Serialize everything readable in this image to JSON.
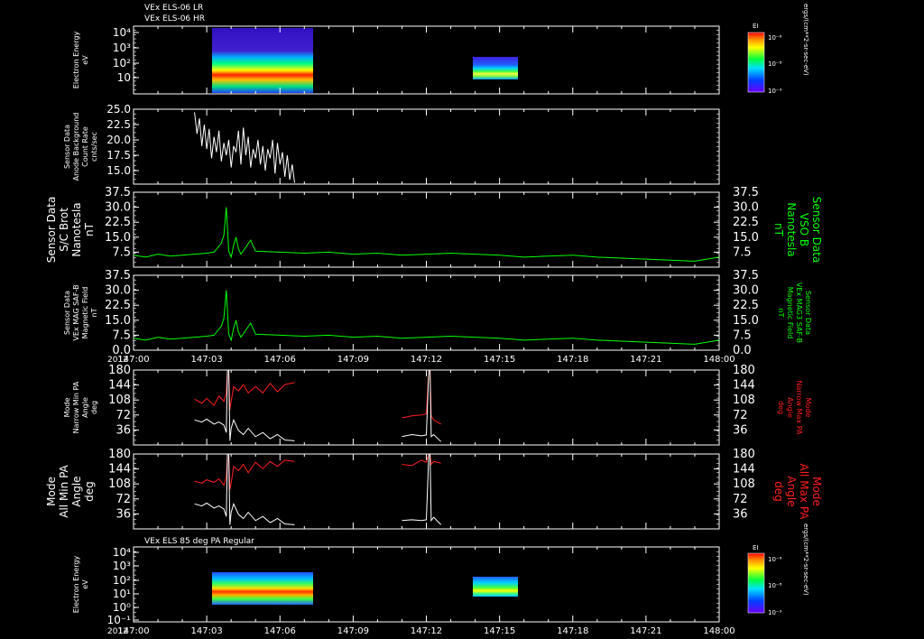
{
  "header": {
    "line1": "VEx ELS-06 LR",
    "line2": "VEx ELS-06 HR"
  },
  "colors": {
    "bg": "#000000",
    "axis": "#ffffff",
    "green": "#00ff00",
    "red": "#ff2020",
    "white": "#ffffff"
  },
  "colorbar": {
    "title": "EI",
    "units": "ergs/(cm**2-sr-sec-eV)",
    "ticks": [
      "10⁻⁶",
      "10⁻⁸",
      "10⁻⁹"
    ]
  },
  "time_axis": {
    "year": "2012",
    "ticks": [
      "147:00",
      "147:03",
      "147:06",
      "147:09",
      "147:12",
      "147:15",
      "147:18",
      "147:21",
      "148:00"
    ]
  },
  "chart_data": [
    {
      "type": "heatmap",
      "ylabel": [
        "Electron Energy",
        "eV"
      ],
      "yticks": [
        "10⁴",
        "10³",
        "10²",
        "10"
      ],
      "log_y": true,
      "colorbar": true,
      "blocks_minutes": [
        [
          2.4,
          6.6
        ],
        [
          11.0,
          12.7
        ]
      ]
    },
    {
      "type": "line",
      "ylabel": [
        "Sensor Data",
        "Anode Background",
        "Count Rate",
        "cnts/sec"
      ],
      "yticks": [
        "25.0",
        "22.5",
        "20.0",
        "17.5",
        "15.0"
      ],
      "ylim": [
        12.8,
        25.0
      ],
      "color": "white",
      "x_minutes": [
        2.5,
        2.6,
        2.7,
        2.8,
        2.9,
        3.0,
        3.1,
        3.2,
        3.3,
        3.4,
        3.5,
        3.6,
        3.7,
        3.8,
        3.9,
        4.0,
        4.1,
        4.2,
        4.3,
        4.4,
        4.5,
        4.6,
        4.7,
        4.8,
        4.9,
        5.0,
        5.1,
        5.2,
        5.3,
        5.4,
        5.5,
        5.6,
        5.7,
        5.8,
        5.9,
        6.0,
        6.1,
        6.2,
        6.3,
        6.4,
        6.5,
        6.6
      ],
      "values": [
        24.5,
        21.0,
        23.5,
        19.0,
        22.5,
        18.5,
        21.8,
        17.0,
        20.5,
        18.0,
        21.5,
        16.5,
        19.5,
        17.5,
        20.0,
        15.5,
        19.0,
        18.0,
        21.5,
        16.0,
        22.0,
        17.5,
        20.5,
        15.5,
        18.5,
        17.0,
        20.0,
        16.0,
        19.0,
        15.0,
        18.5,
        17.0,
        20.0,
        14.5,
        19.5,
        16.0,
        18.0,
        14.0,
        17.5,
        13.5,
        16.0,
        13.0
      ]
    },
    {
      "type": "line",
      "ylabel": [
        "Sensor Data",
        "S/C Brot",
        "Nanotesla",
        "nT"
      ],
      "ylabel_right": [
        "Sensor Data",
        "VSO B",
        "Nanotesla",
        "nT"
      ],
      "yticks": [
        "37.5",
        "30.0",
        "22.5",
        "15.0",
        "7.5"
      ],
      "ylim": [
        0,
        37.5
      ],
      "color": "green",
      "x_minutes": [
        0,
        0.5,
        1.0,
        1.5,
        2.0,
        2.5,
        3.0,
        3.3,
        3.6,
        3.7,
        3.8,
        3.9,
        4.0,
        4.1,
        4.2,
        4.3,
        4.4,
        4.6,
        4.8,
        5.0,
        6.0,
        7.0,
        8.0,
        9.0,
        10.0,
        11.0,
        12.0,
        13.0,
        14.0,
        15.0,
        16.0,
        17.0,
        18.0,
        19.0,
        20.0,
        21.0,
        22.0,
        23.0,
        24.0
      ],
      "values": [
        6.0,
        5.0,
        6.5,
        5.5,
        6.0,
        6.5,
        7.0,
        7.5,
        12.0,
        16.0,
        30.0,
        8.0,
        5.0,
        11.0,
        15.0,
        9.0,
        6.5,
        10.0,
        13.5,
        8.0,
        7.5,
        7.0,
        7.5,
        6.5,
        7.0,
        6.0,
        6.5,
        7.0,
        6.5,
        6.0,
        5.0,
        5.5,
        6.0,
        5.0,
        4.5,
        4.0,
        3.5,
        3.0,
        5.0
      ]
    },
    {
      "type": "line",
      "ylabel": [
        "Sensor Data",
        "VEx MAG SAF-B",
        "Magnetic Field",
        "nT"
      ],
      "ylabel_right": [
        "Sensor Data",
        "VEx MAG3 SAF-B",
        "Magnetic Field",
        "nT"
      ],
      "yticks": [
        "37.5",
        "30.0",
        "22.5",
        "15.0",
        "7.5",
        "0.0"
      ],
      "ylim": [
        0,
        37.5
      ],
      "color": "green",
      "x_minutes": [
        0,
        0.5,
        1.0,
        1.5,
        2.0,
        2.5,
        3.0,
        3.3,
        3.6,
        3.7,
        3.8,
        3.9,
        4.0,
        4.1,
        4.2,
        4.3,
        4.4,
        4.6,
        4.8,
        5.0,
        6.0,
        7.0,
        8.0,
        9.0,
        10.0,
        11.0,
        12.0,
        13.0,
        14.0,
        15.0,
        16.0,
        17.0,
        18.0,
        19.0,
        20.0,
        21.0,
        22.0,
        23.0,
        24.0
      ],
      "values": [
        6.0,
        5.0,
        6.5,
        5.5,
        6.0,
        6.5,
        7.0,
        7.5,
        12.0,
        16.0,
        30.0,
        8.0,
        5.0,
        11.0,
        15.0,
        9.0,
        6.5,
        10.0,
        13.5,
        8.0,
        7.5,
        7.0,
        7.5,
        6.5,
        7.0,
        6.0,
        6.5,
        7.0,
        6.5,
        6.0,
        5.0,
        5.5,
        6.0,
        5.0,
        4.5,
        4.0,
        3.5,
        3.0,
        5.0
      ]
    },
    {
      "type": "line",
      "ylabel": [
        "Mode",
        "Narrow Min PA",
        "Angle",
        "deg"
      ],
      "ylabel_right": [
        "Mode",
        "Narrow Max PA",
        "Angle",
        "deg"
      ],
      "yticks": [
        "180",
        "144",
        "108",
        "72",
        "36"
      ],
      "ylim": [
        0,
        180
      ],
      "series": [
        {
          "color": "red",
          "x_minutes": [
            2.5,
            2.8,
            3.0,
            3.3,
            3.5,
            3.7,
            3.8,
            3.85,
            3.9,
            3.95,
            4.0,
            4.1,
            4.3,
            4.5,
            4.7,
            5.0,
            5.3,
            5.6,
            5.9,
            6.2,
            6.6,
            null,
            11.0,
            11.4,
            11.8,
            12.0,
            12.1,
            12.15,
            12.2,
            12.3,
            12.6
          ],
          "values": [
            110,
            100,
            112,
            95,
            118,
            105,
            125,
            180,
            180,
            85,
            105,
            140,
            130,
            145,
            125,
            140,
            125,
            148,
            128,
            145,
            150,
            null,
            65,
            70,
            72,
            75,
            180,
            180,
            70,
            60,
            50
          ]
        },
        {
          "color": "white",
          "x_minutes": [
            2.5,
            2.8,
            3.0,
            3.3,
            3.5,
            3.7,
            3.8,
            3.85,
            3.9,
            3.95,
            4.0,
            4.1,
            4.3,
            4.5,
            4.7,
            5.0,
            5.3,
            5.6,
            5.9,
            6.2,
            6.6,
            null,
            11.0,
            11.4,
            11.8,
            12.0,
            12.1,
            12.15,
            12.2,
            12.3,
            12.6
          ],
          "values": [
            60,
            55,
            62,
            50,
            55,
            48,
            30,
            180,
            180,
            10,
            40,
            60,
            35,
            25,
            40,
            20,
            30,
            15,
            25,
            12,
            10,
            null,
            20,
            25,
            22,
            24,
            180,
            180,
            20,
            25,
            8
          ]
        }
      ]
    },
    {
      "type": "line",
      "ylabel": [
        "Mode",
        "All Min PA",
        "Angle",
        "deg"
      ],
      "ylabel_right": [
        "Mode",
        "All Max PA",
        "Angle",
        "deg"
      ],
      "yticks": [
        "180",
        "144",
        "108",
        "72",
        "36"
      ],
      "ylim": [
        0,
        180
      ],
      "series": [
        {
          "color": "red",
          "x_minutes": [
            2.5,
            2.8,
            3.0,
            3.3,
            3.5,
            3.7,
            3.8,
            3.85,
            3.9,
            3.95,
            4.0,
            4.1,
            4.3,
            4.5,
            4.7,
            5.0,
            5.3,
            5.6,
            5.9,
            6.2,
            6.6,
            null,
            11.0,
            11.4,
            11.8,
            12.0,
            12.1,
            12.15,
            12.2,
            12.3,
            12.6
          ],
          "values": [
            115,
            110,
            118,
            112,
            120,
            105,
            125,
            180,
            180,
            95,
            110,
            150,
            140,
            155,
            135,
            160,
            145,
            162,
            150,
            165,
            162,
            null,
            155,
            152,
            165,
            160,
            180,
            180,
            155,
            162,
            158
          ]
        },
        {
          "color": "white",
          "x_minutes": [
            2.5,
            2.8,
            3.0,
            3.3,
            3.5,
            3.7,
            3.8,
            3.85,
            3.9,
            3.95,
            4.0,
            4.1,
            4.3,
            4.5,
            4.7,
            5.0,
            5.3,
            5.6,
            5.9,
            6.2,
            6.6,
            null,
            11.0,
            11.4,
            11.8,
            12.0,
            12.1,
            12.15,
            12.2,
            12.3,
            12.6
          ],
          "values": [
            60,
            55,
            62,
            50,
            55,
            48,
            30,
            180,
            180,
            10,
            40,
            60,
            35,
            25,
            40,
            20,
            30,
            15,
            25,
            12,
            10,
            null,
            20,
            22,
            20,
            22,
            180,
            180,
            20,
            28,
            10
          ]
        }
      ]
    },
    {
      "type": "heatmap",
      "title": "VEx ELS 85 deg PA Regular",
      "ylabel": [
        "Electron Energy",
        "eV"
      ],
      "yticks": [
        "10⁴",
        "10³",
        "10²",
        "10¹",
        "10⁰",
        "10⁻¹"
      ],
      "log_y": true,
      "colorbar": true,
      "blocks_minutes": [
        [
          2.4,
          6.6
        ],
        [
          11.0,
          12.7
        ]
      ]
    }
  ]
}
